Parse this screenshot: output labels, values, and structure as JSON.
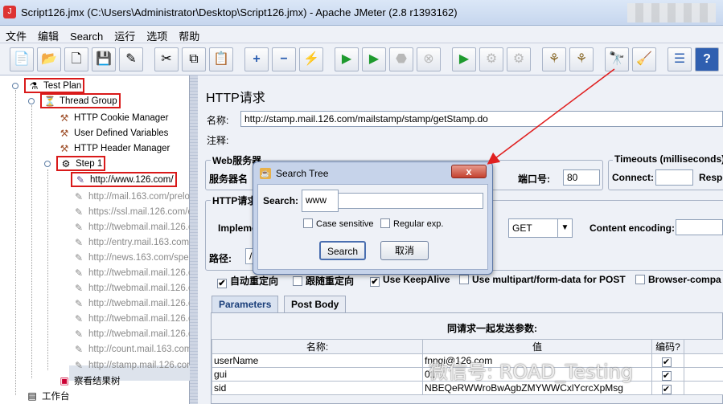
{
  "window": {
    "title": "Script126.jmx (C:\\Users\\Administrator\\Desktop\\Script126.jmx) - Apache JMeter (2.8 r1393162)"
  },
  "menu": [
    "文件",
    "编辑",
    "Search",
    "运行",
    "选项",
    "帮助"
  ],
  "toolbar": {
    "icons": [
      "new-icon",
      "open-icon",
      "close-icon",
      "save-icon",
      "save-as-icon",
      "cut-icon",
      "copy-icon",
      "paste-icon",
      "expand-icon",
      "collapse-icon",
      "toggle-icon",
      "start-icon",
      "start-no-pause-icon",
      "stop-icon",
      "shutdown-icon",
      "remote-start-icon",
      "remote-stop-icon",
      "remote-shutdown-icon",
      "clear-icon",
      "clear-all-icon",
      "search-icon",
      "reset-search-icon",
      "function-helper-icon",
      "help-icon"
    ]
  },
  "tree": {
    "test_plan": "Test Plan",
    "thread_group": "Thread Group",
    "cookie_manager": "HTTP Cookie Manager",
    "user_vars": "User Defined Variables",
    "header_manager": "HTTP Header Manager",
    "step": "Step 1",
    "requests": [
      "http://www.126.com/",
      "http://mail.163.com/preloa",
      "https://ssl.mail.126.com/e",
      "http://twebmail.mail.126.c",
      "http://entry.mail.163.com",
      "http://news.163.com/spe",
      "http://twebmail.mail.126.c",
      "http://twebmail.mail.126.c",
      "http://twebmail.mail.126.c",
      "http://twebmail.mail.126.c",
      "http://twebmail.mail.126.c",
      "http://count.mail.163.com",
      "http://stamp.mail.126.com"
    ],
    "listener": "察看结果树",
    "workbench": "工作台"
  },
  "panel": {
    "heading": "HTTP请求",
    "name_label": "名称:",
    "name_value": "http://stamp.mail.126.com/mailstamp/stamp/getStamp.do",
    "comment_label": "注释:",
    "web_server_group": "Web服务器",
    "server_label": "服务器名",
    "port_label": "端口号:",
    "port_value": "80",
    "timeouts_group": "Timeouts (milliseconds)",
    "connect_label": "Connect:",
    "response_label": "Respo",
    "http_request_group": "HTTP请求",
    "impl_label": "Impleme",
    "method_value": "GET",
    "encoding_label": "Content encoding:",
    "path_label": "路径:",
    "path_value": "/r",
    "options": [
      {
        "label": "自动重定向",
        "checked": true
      },
      {
        "label": "跟随重定向",
        "checked": false
      },
      {
        "label": "Use KeepAlive",
        "checked": true
      },
      {
        "label": "Use multipart/form-data for POST",
        "checked": false
      },
      {
        "label": "Browser-compa",
        "checked": false
      }
    ],
    "tabs": [
      "Parameters",
      "Post Body"
    ],
    "params_caption": "同请求一起发送参数:",
    "columns": [
      "名称:",
      "值",
      "编码?"
    ],
    "rows": [
      {
        "name": "userName",
        "value": "fnngi@126.com",
        "encode": true
      },
      {
        "name": "gui",
        "value": "01",
        "encode": true
      },
      {
        "name": "sid",
        "value": "NBEQeRWWroBwAgbZMYWWCxlYcrcXpMsg",
        "encode": true
      }
    ]
  },
  "dialog": {
    "title": "Search Tree",
    "close": "x",
    "search_label": "Search:",
    "search_value": "www",
    "case_sensitive": "Case sensitive",
    "regular_exp": "Regular exp.",
    "search_button": "Search",
    "cancel_button": "取消"
  },
  "watermark": "微信号: ROAD_Testing",
  "colors": {
    "annotation_red": "#d91a1a",
    "arrow_red": "#e02020",
    "tree_selected": "#dde3ec"
  }
}
